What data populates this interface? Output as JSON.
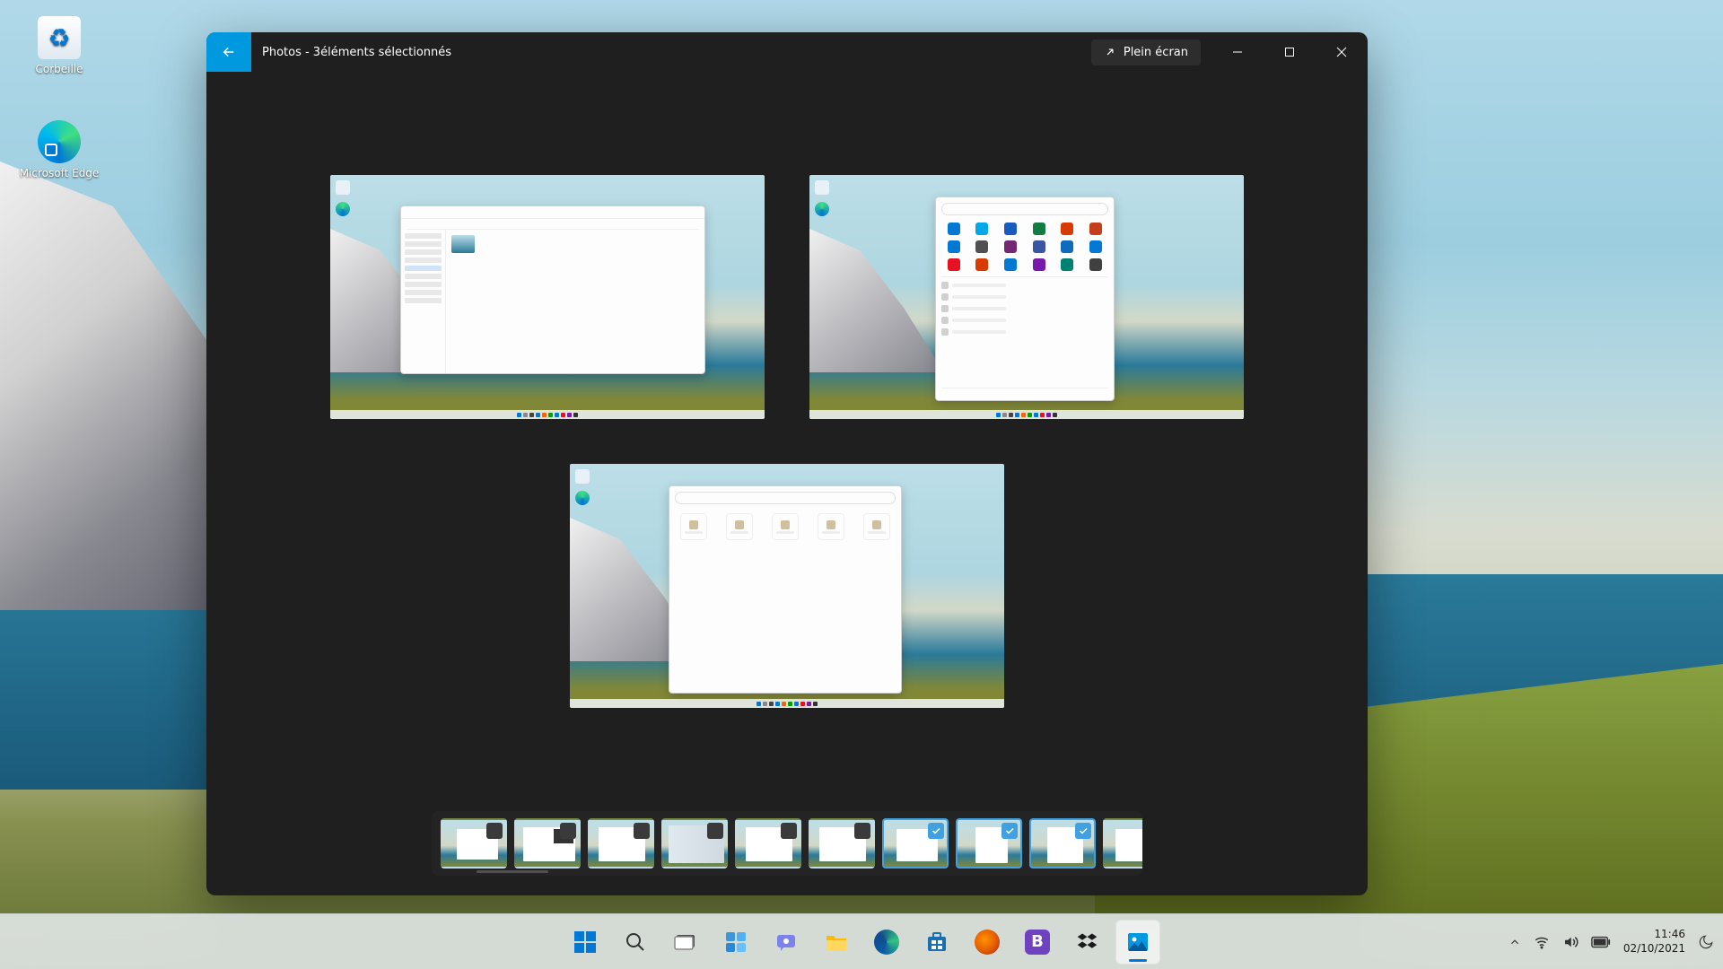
{
  "desktop_icons": {
    "recycle_bin": "Corbeille",
    "edge": "Microsoft Edge"
  },
  "app": {
    "title": "Photos - 3éléments sélectionnés",
    "fullscreen_label": "Plein écran",
    "selected_count": 3
  },
  "filmstrip": {
    "items": [
      {
        "selected": false
      },
      {
        "selected": false
      },
      {
        "selected": false
      },
      {
        "selected": false
      },
      {
        "selected": false
      },
      {
        "selected": false
      },
      {
        "selected": true
      },
      {
        "selected": true
      },
      {
        "selected": true
      },
      {
        "selected": false
      }
    ]
  },
  "taskbar": {
    "icons": [
      {
        "name": "start",
        "active": false
      },
      {
        "name": "search",
        "active": false
      },
      {
        "name": "task-view",
        "active": false
      },
      {
        "name": "widgets",
        "active": false
      },
      {
        "name": "chat",
        "active": false
      },
      {
        "name": "file-explorer",
        "active": false
      },
      {
        "name": "edge",
        "active": false
      },
      {
        "name": "microsoft-store",
        "active": false
      },
      {
        "name": "firefox",
        "active": false
      },
      {
        "name": "app-b",
        "active": false
      },
      {
        "name": "dropbox",
        "active": false
      },
      {
        "name": "photos",
        "active": true
      }
    ]
  },
  "tray": {
    "time": "11:46",
    "date": "02/10/2021"
  }
}
